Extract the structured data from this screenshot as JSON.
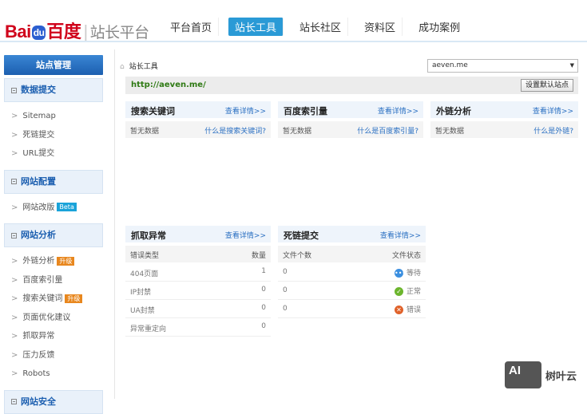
{
  "header": {
    "logo_bai": "Bai",
    "logo_du": "du",
    "logo_cn": "百度",
    "logo_platform": "站长平台",
    "nav": [
      {
        "label": "平台首页",
        "active": false
      },
      {
        "label": "站长工具",
        "active": true
      },
      {
        "label": "站长社区",
        "active": false
      },
      {
        "label": "资料区",
        "active": false
      },
      {
        "label": "成功案例",
        "active": false
      }
    ]
  },
  "sidebar": {
    "title": "站点管理",
    "sections": [
      {
        "label": "数据提交",
        "items": [
          {
            "label": "Sitemap"
          },
          {
            "label": "死链提交"
          },
          {
            "label": "URL提交"
          }
        ]
      },
      {
        "label": "网站配置",
        "items": [
          {
            "label": "网站改版",
            "badge": "Beta"
          }
        ]
      },
      {
        "label": "网站分析",
        "items": [
          {
            "label": "外链分析",
            "badge": "升级"
          },
          {
            "label": "百度索引量"
          },
          {
            "label": "搜索关键词",
            "badge": "升级"
          },
          {
            "label": "页面优化建议"
          },
          {
            "label": "抓取异常"
          },
          {
            "label": "压力反馈"
          },
          {
            "label": "Robots"
          }
        ]
      },
      {
        "label": "网站安全",
        "items": []
      }
    ]
  },
  "colors": {
    "beta": "#1aa3d9",
    "upgrade": "#e8871e",
    "accent": "#2a9ad6"
  },
  "main": {
    "breadcrumb": "站长工具",
    "site_select": "aeven.me",
    "site_url": "http://aeven.me/",
    "set_default_button": "设置默认站点",
    "panels": [
      {
        "title": "搜索关键词",
        "link": "查看详情>>",
        "status": "暂无数据",
        "help": "什么是搜索关键词?"
      },
      {
        "title": "百度索引量",
        "link": "查看详情>>",
        "status": "暂无数据",
        "help": "什么是百度索引量?"
      },
      {
        "title": "外链分析",
        "link": "查看详情>>",
        "status": "暂无数据",
        "help": "什么是外链?"
      }
    ],
    "crawl": {
      "title": "抓取异常",
      "link": "查看详情>>",
      "columns": [
        "错误类型",
        "数量"
      ],
      "rows": [
        {
          "type": "404页面",
          "count": "1"
        },
        {
          "type": "IP封禁",
          "count": "0"
        },
        {
          "type": "UA封禁",
          "count": "0"
        },
        {
          "type": "异常重定向",
          "count": "0"
        }
      ]
    },
    "deadlink": {
      "title": "死链提交",
      "link": "查看详情>>",
      "columns": [
        "文件个数",
        "文件状态"
      ],
      "rows": [
        {
          "count": "0",
          "status": "等待",
          "icon": "pending-icon"
        },
        {
          "count": "0",
          "status": "正常",
          "icon": "check-icon"
        },
        {
          "count": "0",
          "status": "错误",
          "icon": "error-icon"
        }
      ]
    }
  },
  "watermark": {
    "logo": "AI",
    "text": "树叶云"
  }
}
